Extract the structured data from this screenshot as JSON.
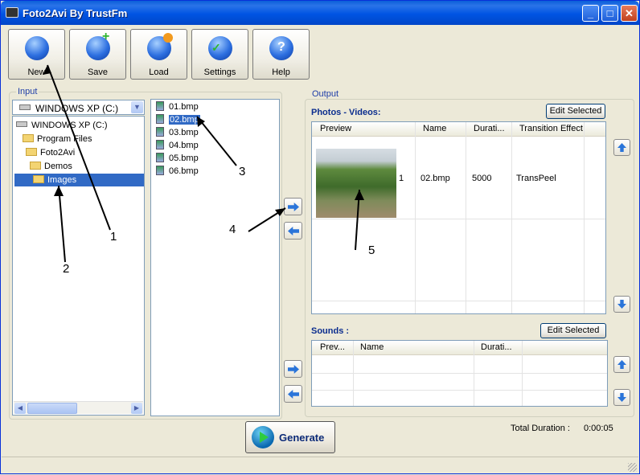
{
  "window": {
    "title": "Foto2Avi By TrustFm"
  },
  "titlebar_buttons": {
    "minimize": "_",
    "maximize": "□",
    "close": "✕"
  },
  "toolbar": [
    {
      "label": "New",
      "icon": "blue-orb-icon"
    },
    {
      "label": "Save",
      "icon": "save-orb-icon"
    },
    {
      "label": "Load",
      "icon": "load-orb-icon"
    },
    {
      "label": "Settings",
      "icon": "settings-orb-icon"
    },
    {
      "label": "Help",
      "icon": "help-orb-icon"
    }
  ],
  "input": {
    "group_label": "Input",
    "drive_combo": "WINDOWS XP (C:)",
    "tree": [
      {
        "label": "WINDOWS XP (C:)",
        "type": "drive"
      },
      {
        "label": "Program Files",
        "type": "folder"
      },
      {
        "label": "Foto2Avi",
        "type": "folder"
      },
      {
        "label": "Demos",
        "type": "folder"
      },
      {
        "label": "Images",
        "type": "folder",
        "selected": true
      }
    ],
    "files": [
      "01.bmp",
      "02.bmp",
      "03.bmp",
      "04.bmp",
      "05.bmp",
      "06.bmp"
    ],
    "selected_file": "02.bmp"
  },
  "output": {
    "group_label": "Output",
    "photos": {
      "title": "Photos - Videos:",
      "edit_button": "Edit Selected",
      "columns": [
        "Preview",
        "Name",
        "Durati...",
        "Transition Effect"
      ],
      "rows": [
        {
          "index": "1",
          "name": "02.bmp",
          "duration": "5000",
          "transition": "TransPeel"
        }
      ]
    },
    "sounds": {
      "title": "Sounds :",
      "edit_button": "Edit Selected",
      "columns": [
        "Prev...",
        "Name",
        "Durati..."
      ]
    }
  },
  "generate_button": "Generate",
  "total_duration": {
    "label": "Total Duration :",
    "value": "0:00:05"
  },
  "annotations": [
    "1",
    "2",
    "3",
    "4",
    "5"
  ]
}
